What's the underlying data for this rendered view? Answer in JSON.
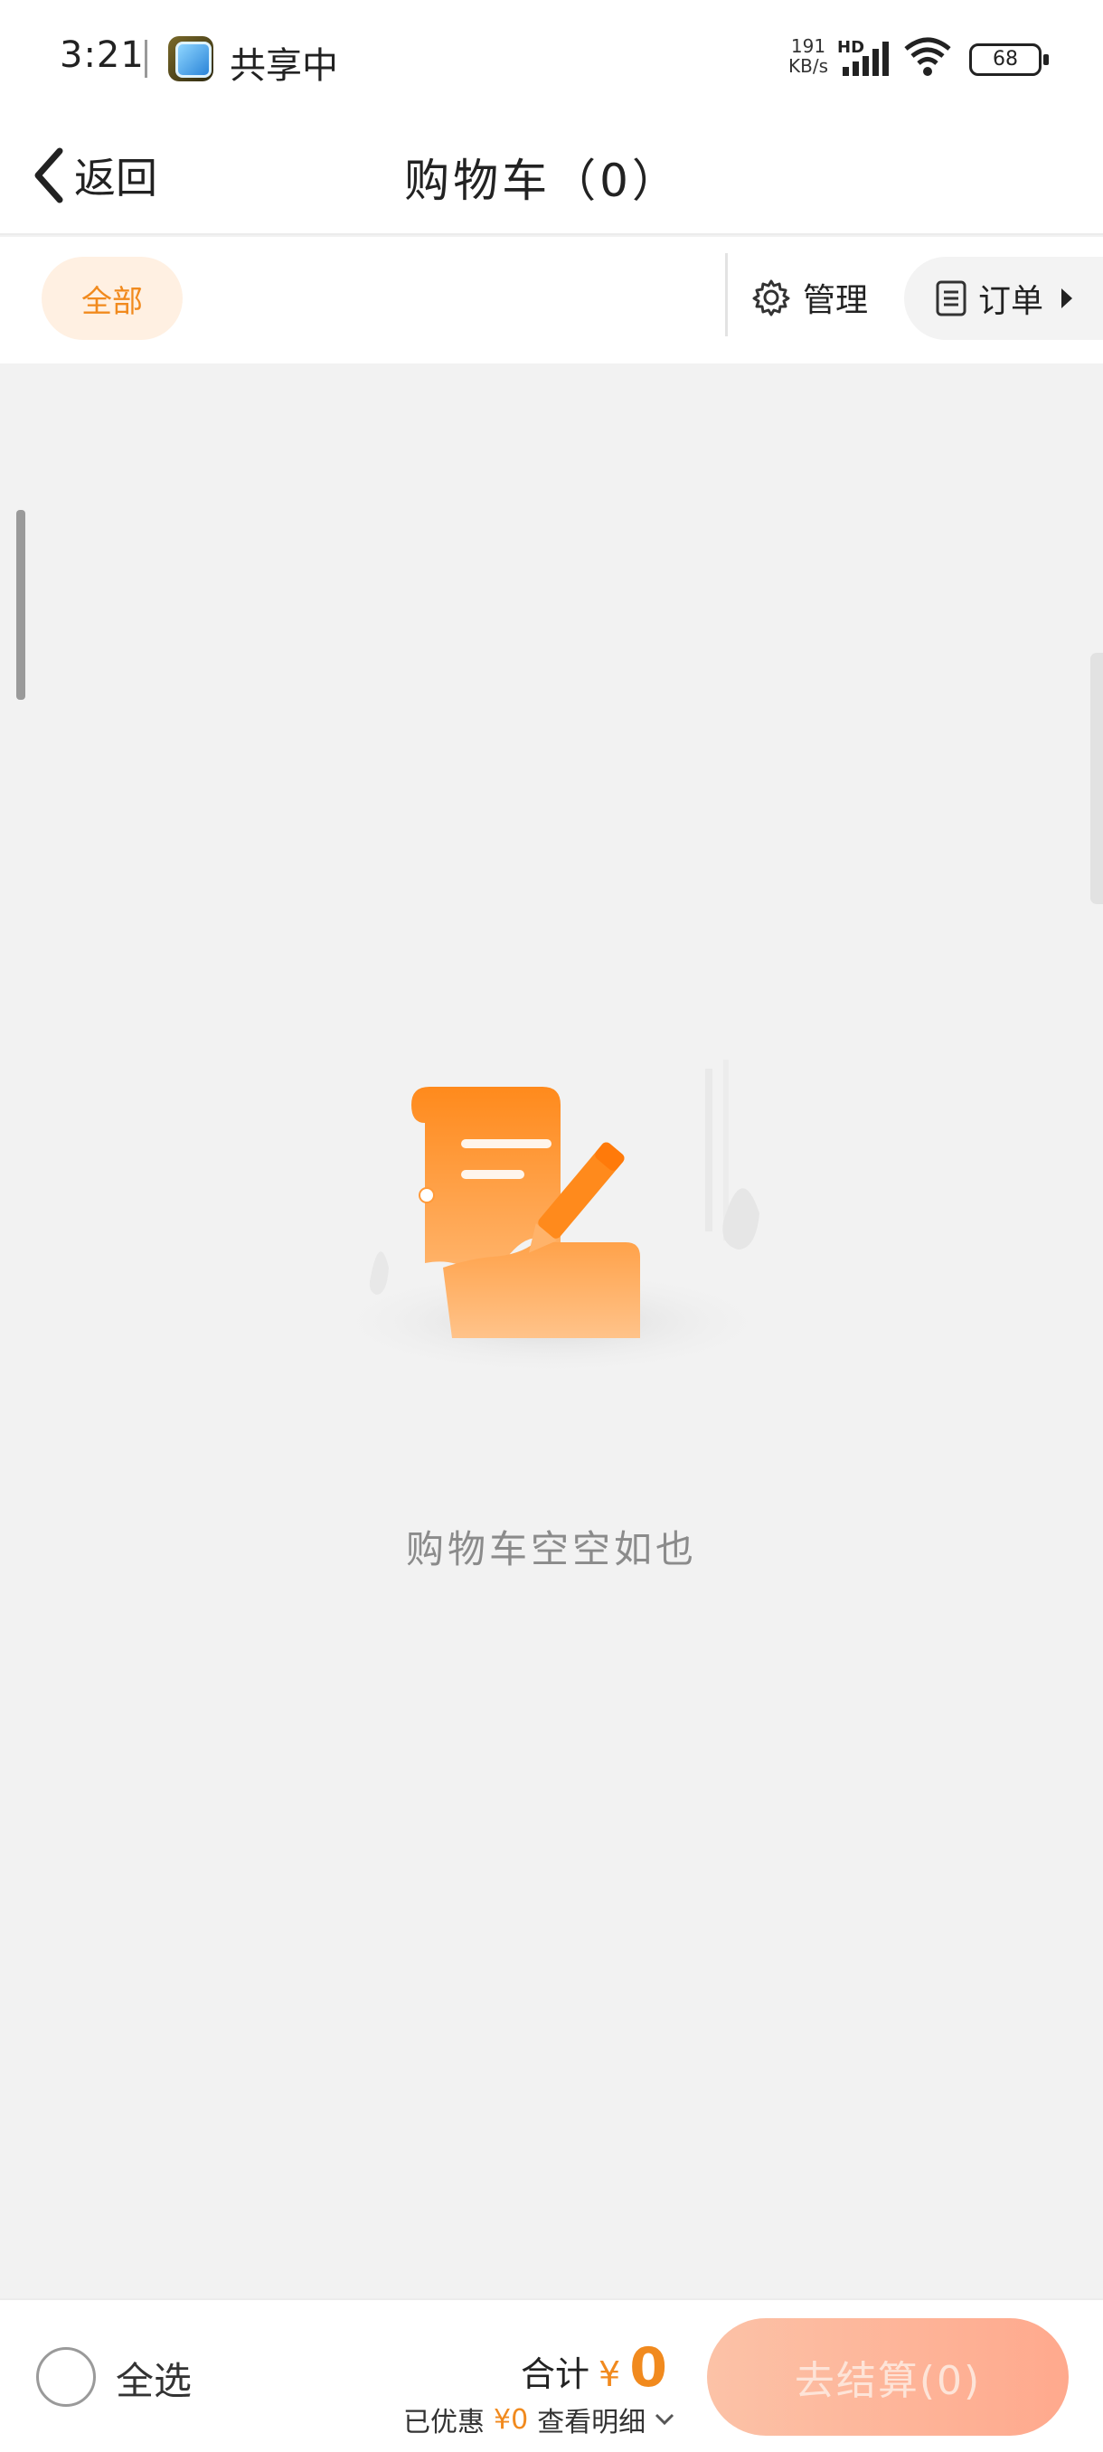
{
  "status_bar": {
    "time": "3:21",
    "share_text": "共享中",
    "net_speed_value": "191",
    "net_speed_unit": "KB/s",
    "network_type": "HD",
    "battery": "68"
  },
  "header": {
    "back_label": "返回",
    "title": "购物车（0）"
  },
  "filter_bar": {
    "all_chip": "全部",
    "manage_label": "管理",
    "orders_label": "订单"
  },
  "empty_state": {
    "message": "购物车空空如也"
  },
  "footer": {
    "select_all_label": "全选",
    "total_label": "合计",
    "currency": "¥",
    "total_value": "0",
    "discount_label": "已优惠",
    "discount_value": "¥0",
    "detail_label": "查看明细",
    "checkout_label": "去结算(0)"
  },
  "colors": {
    "accent": "#f18a1e",
    "checkout_bg": "#ffae92",
    "page_bg": "#f2f2f2"
  }
}
